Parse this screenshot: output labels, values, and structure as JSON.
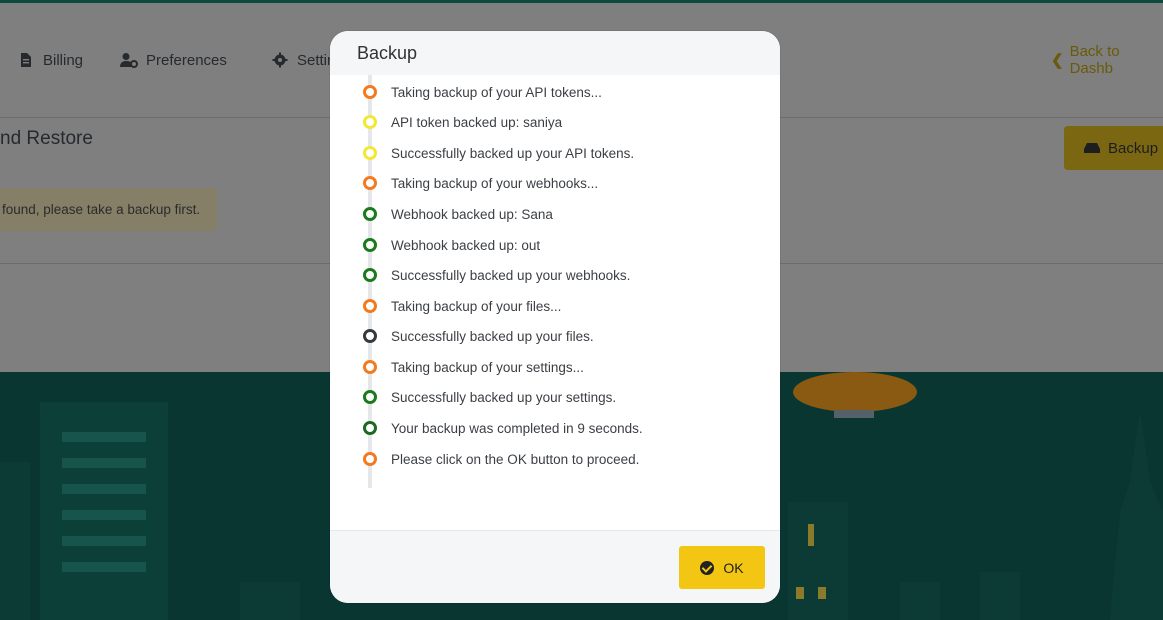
{
  "nav": {
    "billing": "Billing",
    "preferences": "Preferences",
    "settings": "Settin",
    "back": "Back to Dashb"
  },
  "section": {
    "title": "nd Restore",
    "notice": "found, please take a backup first.",
    "backup_button": "Backup"
  },
  "modal": {
    "title": "Backup",
    "ok_label": "OK",
    "log": [
      {
        "text": "Taking backup of your API tokens...",
        "color": "#f47a1f"
      },
      {
        "text": "API token backed up: saniya",
        "color": "#f2e832"
      },
      {
        "text": "Successfully backed up your API tokens.",
        "color": "#f2e832"
      },
      {
        "text": "Taking backup of your webhooks...",
        "color": "#f47a1f"
      },
      {
        "text": "Webhook backed up: Sana",
        "color": "#1b7a1b"
      },
      {
        "text": "Webhook backed up: out",
        "color": "#1b7a1b"
      },
      {
        "text": "Successfully backed up your webhooks.",
        "color": "#1b7a1b"
      },
      {
        "text": "Taking backup of your files...",
        "color": "#f47a1f"
      },
      {
        "text": "Successfully backed up your files.",
        "color": "#343a40"
      },
      {
        "text": "Taking backup of your settings...",
        "color": "#f47a1f"
      },
      {
        "text": "Successfully backed up your settings.",
        "color": "#1b7a1b"
      },
      {
        "text": "Your backup was completed in 9 seconds.",
        "color": "#1b6a22"
      },
      {
        "text": "Please click on the OK button to proceed.",
        "color": "#f47a1f"
      }
    ]
  },
  "colors": {
    "accent": "#f3c614",
    "city_bg": "#0a3631"
  }
}
